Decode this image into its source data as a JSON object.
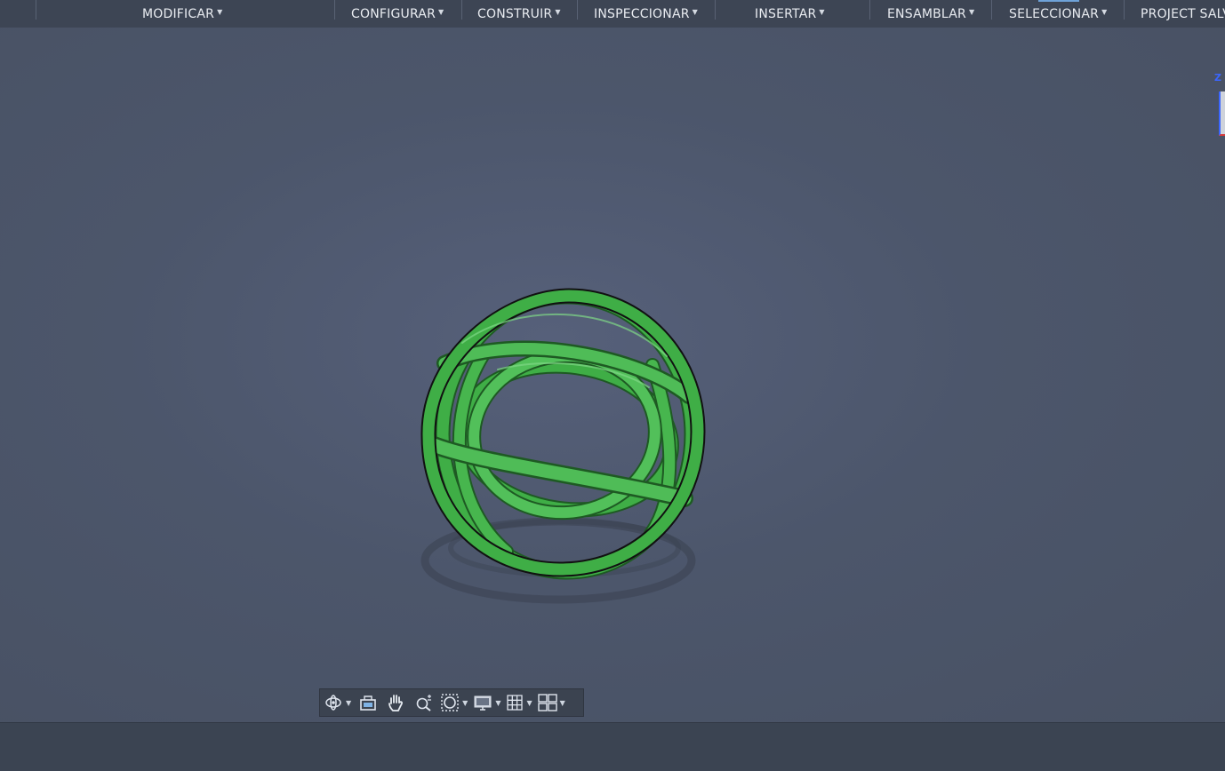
{
  "toolbar": {
    "menus": [
      {
        "label": "MODIFICAR"
      },
      {
        "label": "CONFIGURAR"
      },
      {
        "label": "CONSTRUIR"
      },
      {
        "label": "INSPECCIONAR"
      },
      {
        "label": "INSERTAR"
      },
      {
        "label": "ENSAMBLAR"
      },
      {
        "label": "SELECCIONAR"
      },
      {
        "label": "PROJECT SALV"
      }
    ]
  },
  "viewcube": {
    "axis_label": "Z"
  },
  "model": {
    "name": "sphere-cage",
    "color": "#3fae46"
  },
  "navbar": {
    "tools": [
      "orbit-icon",
      "look-at-icon",
      "pan-hand-icon",
      "zoom-icon",
      "fit-window-icon",
      "display-settings-icon",
      "grid-icon",
      "viewports-icon"
    ]
  },
  "colors": {
    "background": "#4a5466",
    "ribbon": "#3d4554",
    "accent": "#3b66ff"
  }
}
